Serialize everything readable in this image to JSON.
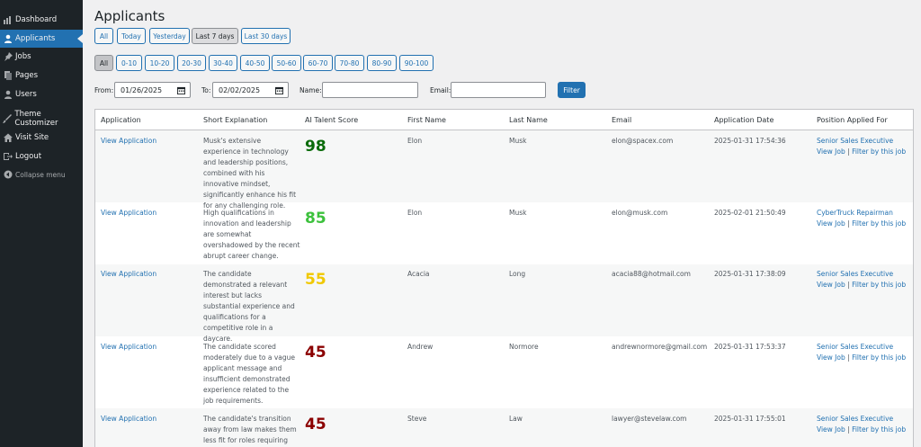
{
  "sidebar": {
    "items": [
      {
        "label": "Dashboard",
        "icon": "dashboard-icon"
      },
      {
        "label": "Applicants",
        "icon": "user-icon"
      },
      {
        "label": "Jobs",
        "icon": "pin-icon"
      },
      {
        "label": "Pages",
        "icon": "pages-icon"
      },
      {
        "label": "Users",
        "icon": "users-icon"
      },
      {
        "label": "Theme Customizer",
        "icon": "brush-icon"
      },
      {
        "label": "Visit Site",
        "icon": "home-icon"
      },
      {
        "label": "Logout",
        "icon": "logout-icon"
      },
      {
        "label": "Collapse menu",
        "icon": "collapse-icon"
      }
    ]
  },
  "page": {
    "title": "Applicants"
  },
  "date_filters": [
    "All",
    "Today",
    "Yesterday",
    "Last 7 days",
    "Last 30 days"
  ],
  "date_filter_selected": "Last 7 days",
  "score_filters": [
    "All",
    "0-10",
    "10-20",
    "20-30",
    "30-40",
    "40-50",
    "50-60",
    "60-70",
    "70-80",
    "80-90",
    "90-100"
  ],
  "score_filter_selected": "All",
  "filters": {
    "from_label": "From:",
    "from_value": "01/26/2025",
    "to_label": "To:",
    "to_value": "02/02/2025",
    "name_label": "Name:",
    "name_value": "",
    "email_label": "Email:",
    "email_value": "",
    "filter_button": "Filter"
  },
  "table": {
    "columns": [
      "Application",
      "Short Explanation",
      "AI Talent Score",
      "First Name",
      "Last Name",
      "Email",
      "Application Date",
      "Position Applied For"
    ],
    "view_job_label": "View Job",
    "filter_job_label": "Filter by this job",
    "separator": "|",
    "rows": [
      {
        "application": "View Application",
        "explanation": "Musk's extensive experience in technology and leadership positions, combined with his innovative mindset, significantly enhance his fit for any challenging role.",
        "score": "98",
        "score_color": "#0a6b0a",
        "first_name": "Elon",
        "last_name": "Musk",
        "email": "elon@spacex.com",
        "date": "2025-01-31 17:54:36",
        "position": "Senior Sales Executive"
      },
      {
        "application": "View Application",
        "explanation": "High qualifications in innovation and leadership are somewhat overshadowed by the recent abrupt career change.",
        "score": "85",
        "score_color": "#3cc13c",
        "first_name": "Elon",
        "last_name": "Musk",
        "email": "elon@musk.com",
        "date": "2025-02-01 21:50:49",
        "position": "CyberTruck Repairman"
      },
      {
        "application": "View Application",
        "explanation": "The candidate demonstrated a relevant interest but lacks substantial experience and qualifications for a competitive role in a daycare.",
        "score": "55",
        "score_color": "#f0c800",
        "first_name": "Acacia",
        "last_name": "Long",
        "email": "acacia88@hotmail.com",
        "date": "2025-01-31 17:38:09",
        "position": "Senior Sales Executive"
      },
      {
        "application": "View Application",
        "explanation": "The candidate scored moderately due to a vague applicant message and insufficient demonstrated experience related to the job requirements.",
        "score": "45",
        "score_color": "#8b0000",
        "first_name": "Andrew",
        "last_name": "Normore",
        "email": "andrewnormore@gmail.com",
        "date": "2025-01-31 17:53:37",
        "position": "Senior Sales Executive"
      },
      {
        "application": "View Application",
        "explanation": "The candidate's transition away from law makes them less fit for roles requiring",
        "score": "45",
        "score_color": "#8b0000",
        "first_name": "Steve",
        "last_name": "Law",
        "email": "lawyer@stevelaw.com",
        "date": "2025-01-31 17:55:01",
        "position": "Senior Sales Executive"
      }
    ]
  }
}
